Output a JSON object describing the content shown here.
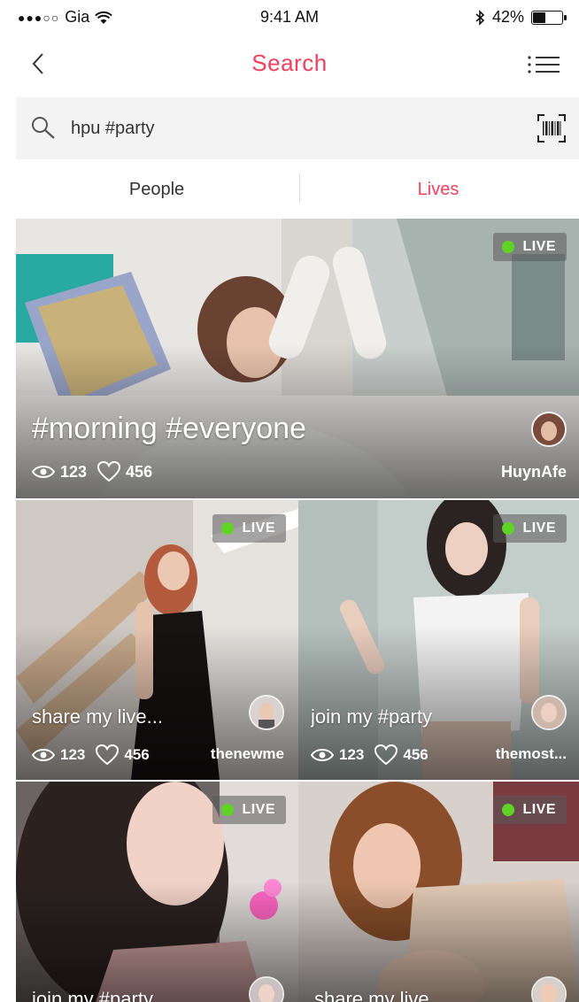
{
  "status_bar": {
    "signal": "●●●○○",
    "carrier": "Gia",
    "time": "9:41 AM",
    "battery_percent": "42%",
    "battery_level": 0.42
  },
  "nav": {
    "title": "Search"
  },
  "search": {
    "value": "hpu #party"
  },
  "tabs": [
    {
      "label": "People",
      "active": false
    },
    {
      "label": "Lives",
      "active": true
    }
  ],
  "colors": {
    "accent": "#f0405d",
    "live_dot": "#5fd424"
  },
  "cards": [
    {
      "badge": "LIVE",
      "title": "#morning #everyone",
      "views": "123",
      "likes": "456",
      "user": "HuynAfe"
    },
    {
      "badge": "LIVE",
      "title": "share my live...",
      "views": "123",
      "likes": "456",
      "user": "thenewme"
    },
    {
      "badge": "LIVE",
      "title": "join my #party",
      "views": "123",
      "likes": "456",
      "user": "themost..."
    },
    {
      "badge": "LIVE",
      "title": "join my #party"
    },
    {
      "badge": "LIVE",
      "title": "share my live"
    }
  ]
}
